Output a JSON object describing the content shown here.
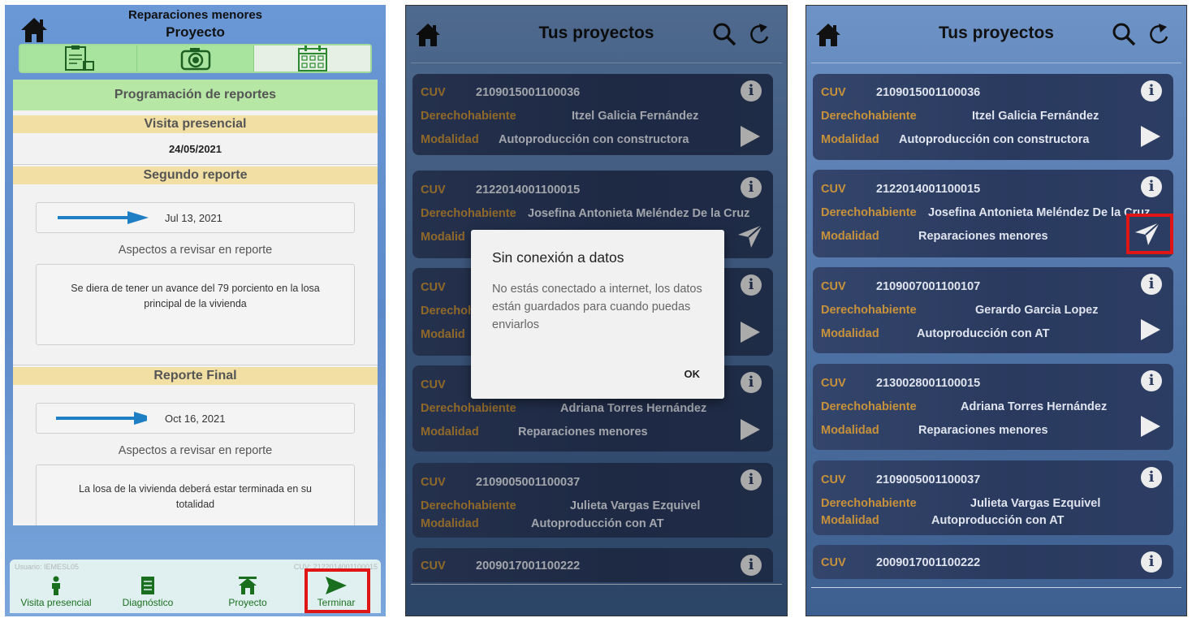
{
  "colors": {
    "red_highlight": "#e01616",
    "label_orange": "#c8923a",
    "green_tab": "#a8e49e",
    "tan_header": "#f2dfa4",
    "nav_green": "#1a6f1f"
  },
  "panel1": {
    "title_line1": "Reparaciones menores",
    "title_line2": "Proyecto",
    "tabs": [
      "clipboard-icon",
      "camera-icon",
      "calendar-icon"
    ],
    "section_title": "Programación de reportes",
    "visita": {
      "header": "Visita presencial",
      "date": "24/05/2021"
    },
    "segundo": {
      "header": "Segundo reporte",
      "date": "Jul 13, 2021",
      "aspect_label": "Aspectos a revisar en reporte",
      "text": "Se diera de tener un avance del 79 porciento en la losa principal de la vivienda"
    },
    "final": {
      "header": "Reporte Final",
      "date": "Oct 16, 2021",
      "aspect_label": "Aspectos a revisar en reporte",
      "text": "La losa de la vivienda deberá estar terminada en su totalidad"
    },
    "footer": {
      "user": "Usuario: IEMESL05",
      "cuv": "CUV: 2122014001100015",
      "nav": [
        "Visita presencial",
        "Diagnóstico",
        "Proyecto",
        "Terminar"
      ]
    }
  },
  "list_header": {
    "title": "Tus proyectos"
  },
  "labels": {
    "cuv": "CUV",
    "derecho": "Derechohabiente",
    "modalidad": "Modalidad"
  },
  "panel2": {
    "projects": [
      {
        "cuv": "2109015001100036",
        "derecho": "Itzel Galicia Fernández",
        "modalidad": "Autoproducción con constructora"
      },
      {
        "cuv": "2122014001100015",
        "derecho": "Josefina Antonieta Meléndez De la Cruz",
        "modalidad": ""
      },
      {
        "cuv": "",
        "derecho": "",
        "modalidad": ""
      },
      {
        "cuv": "",
        "derecho": "Adriana Torres Hernández",
        "modalidad": "Reparaciones menores"
      },
      {
        "cuv": "2109005001100037",
        "derecho": "Julieta Vargas Ezquivel",
        "modalidad": "Autoproducción con AT"
      },
      {
        "cuv": "2009017001100222",
        "derecho": "",
        "modalidad": ""
      }
    ],
    "dialog": {
      "title": "Sin conexión a datos",
      "message": "No estás conectado a internet, los datos están guardados para cuando puedas enviarlos",
      "ok": "OK"
    },
    "partial_labels": {
      "modal_short": "Modalid",
      "derecho_short": "Derechoh",
      "modal_short2": "Modalid"
    }
  },
  "panel3": {
    "projects": [
      {
        "cuv": "2109015001100036",
        "derecho": "Itzel Galicia Fernández",
        "modalidad": "Autoproducción con constructora"
      },
      {
        "cuv": "2122014001100015",
        "derecho": "Josefina Antonieta Meléndez De la Cruz",
        "modalidad": "Reparaciones menores"
      },
      {
        "cuv": "2109007001100107",
        "derecho": "Gerardo Garcia Lopez",
        "modalidad": "Autoproducción con AT"
      },
      {
        "cuv": "2130028001100015",
        "derecho": "Adriana Torres Hernández",
        "modalidad": "Reparaciones menores"
      },
      {
        "cuv": "2109005001100037",
        "derecho": "Julieta Vargas Ezquivel",
        "modalidad": "Autoproducción con AT"
      },
      {
        "cuv": "2009017001100222",
        "derecho": "",
        "modalidad": ""
      }
    ]
  }
}
